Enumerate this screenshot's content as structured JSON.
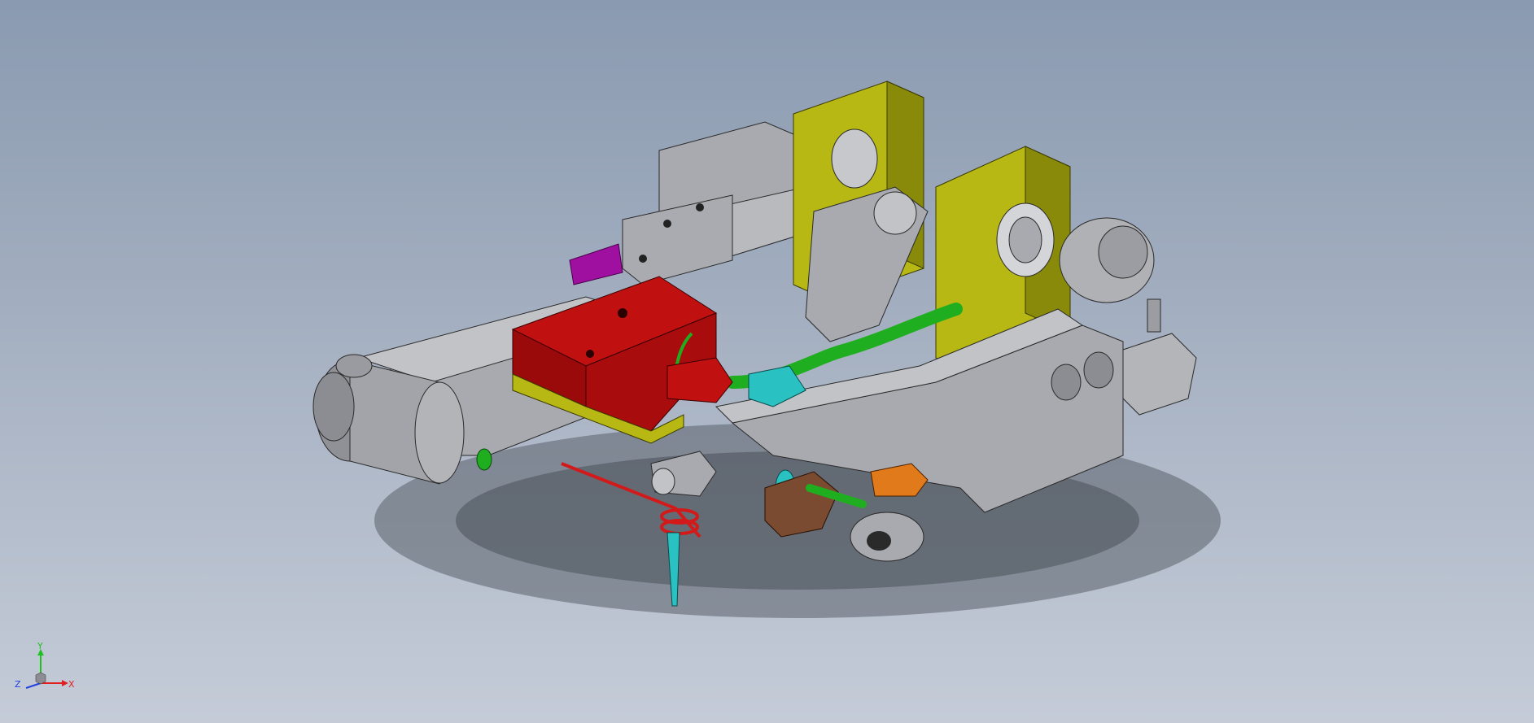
{
  "viewport": {
    "background_top": "#8a9ab0",
    "background_bottom": "#c5ccd8"
  },
  "model": {
    "colors": {
      "gray": "#a9aaaf",
      "gray_dark": "#808186",
      "gray_light": "#c2c3c7",
      "olive": "#b8b814",
      "olive_dark": "#8a8a0a",
      "red": "#c01010",
      "red_dark": "#8a0808",
      "green": "#1fae1f",
      "cyan": "#29c1c1",
      "purple": "#a010a0",
      "brown": "#7a4b30",
      "orange": "#e07a1a"
    }
  },
  "triad": {
    "x_label": "X",
    "y_label": "Y",
    "z_label": "Z",
    "x_color": "#e02020",
    "y_color": "#20c020",
    "z_color": "#2040e0"
  }
}
